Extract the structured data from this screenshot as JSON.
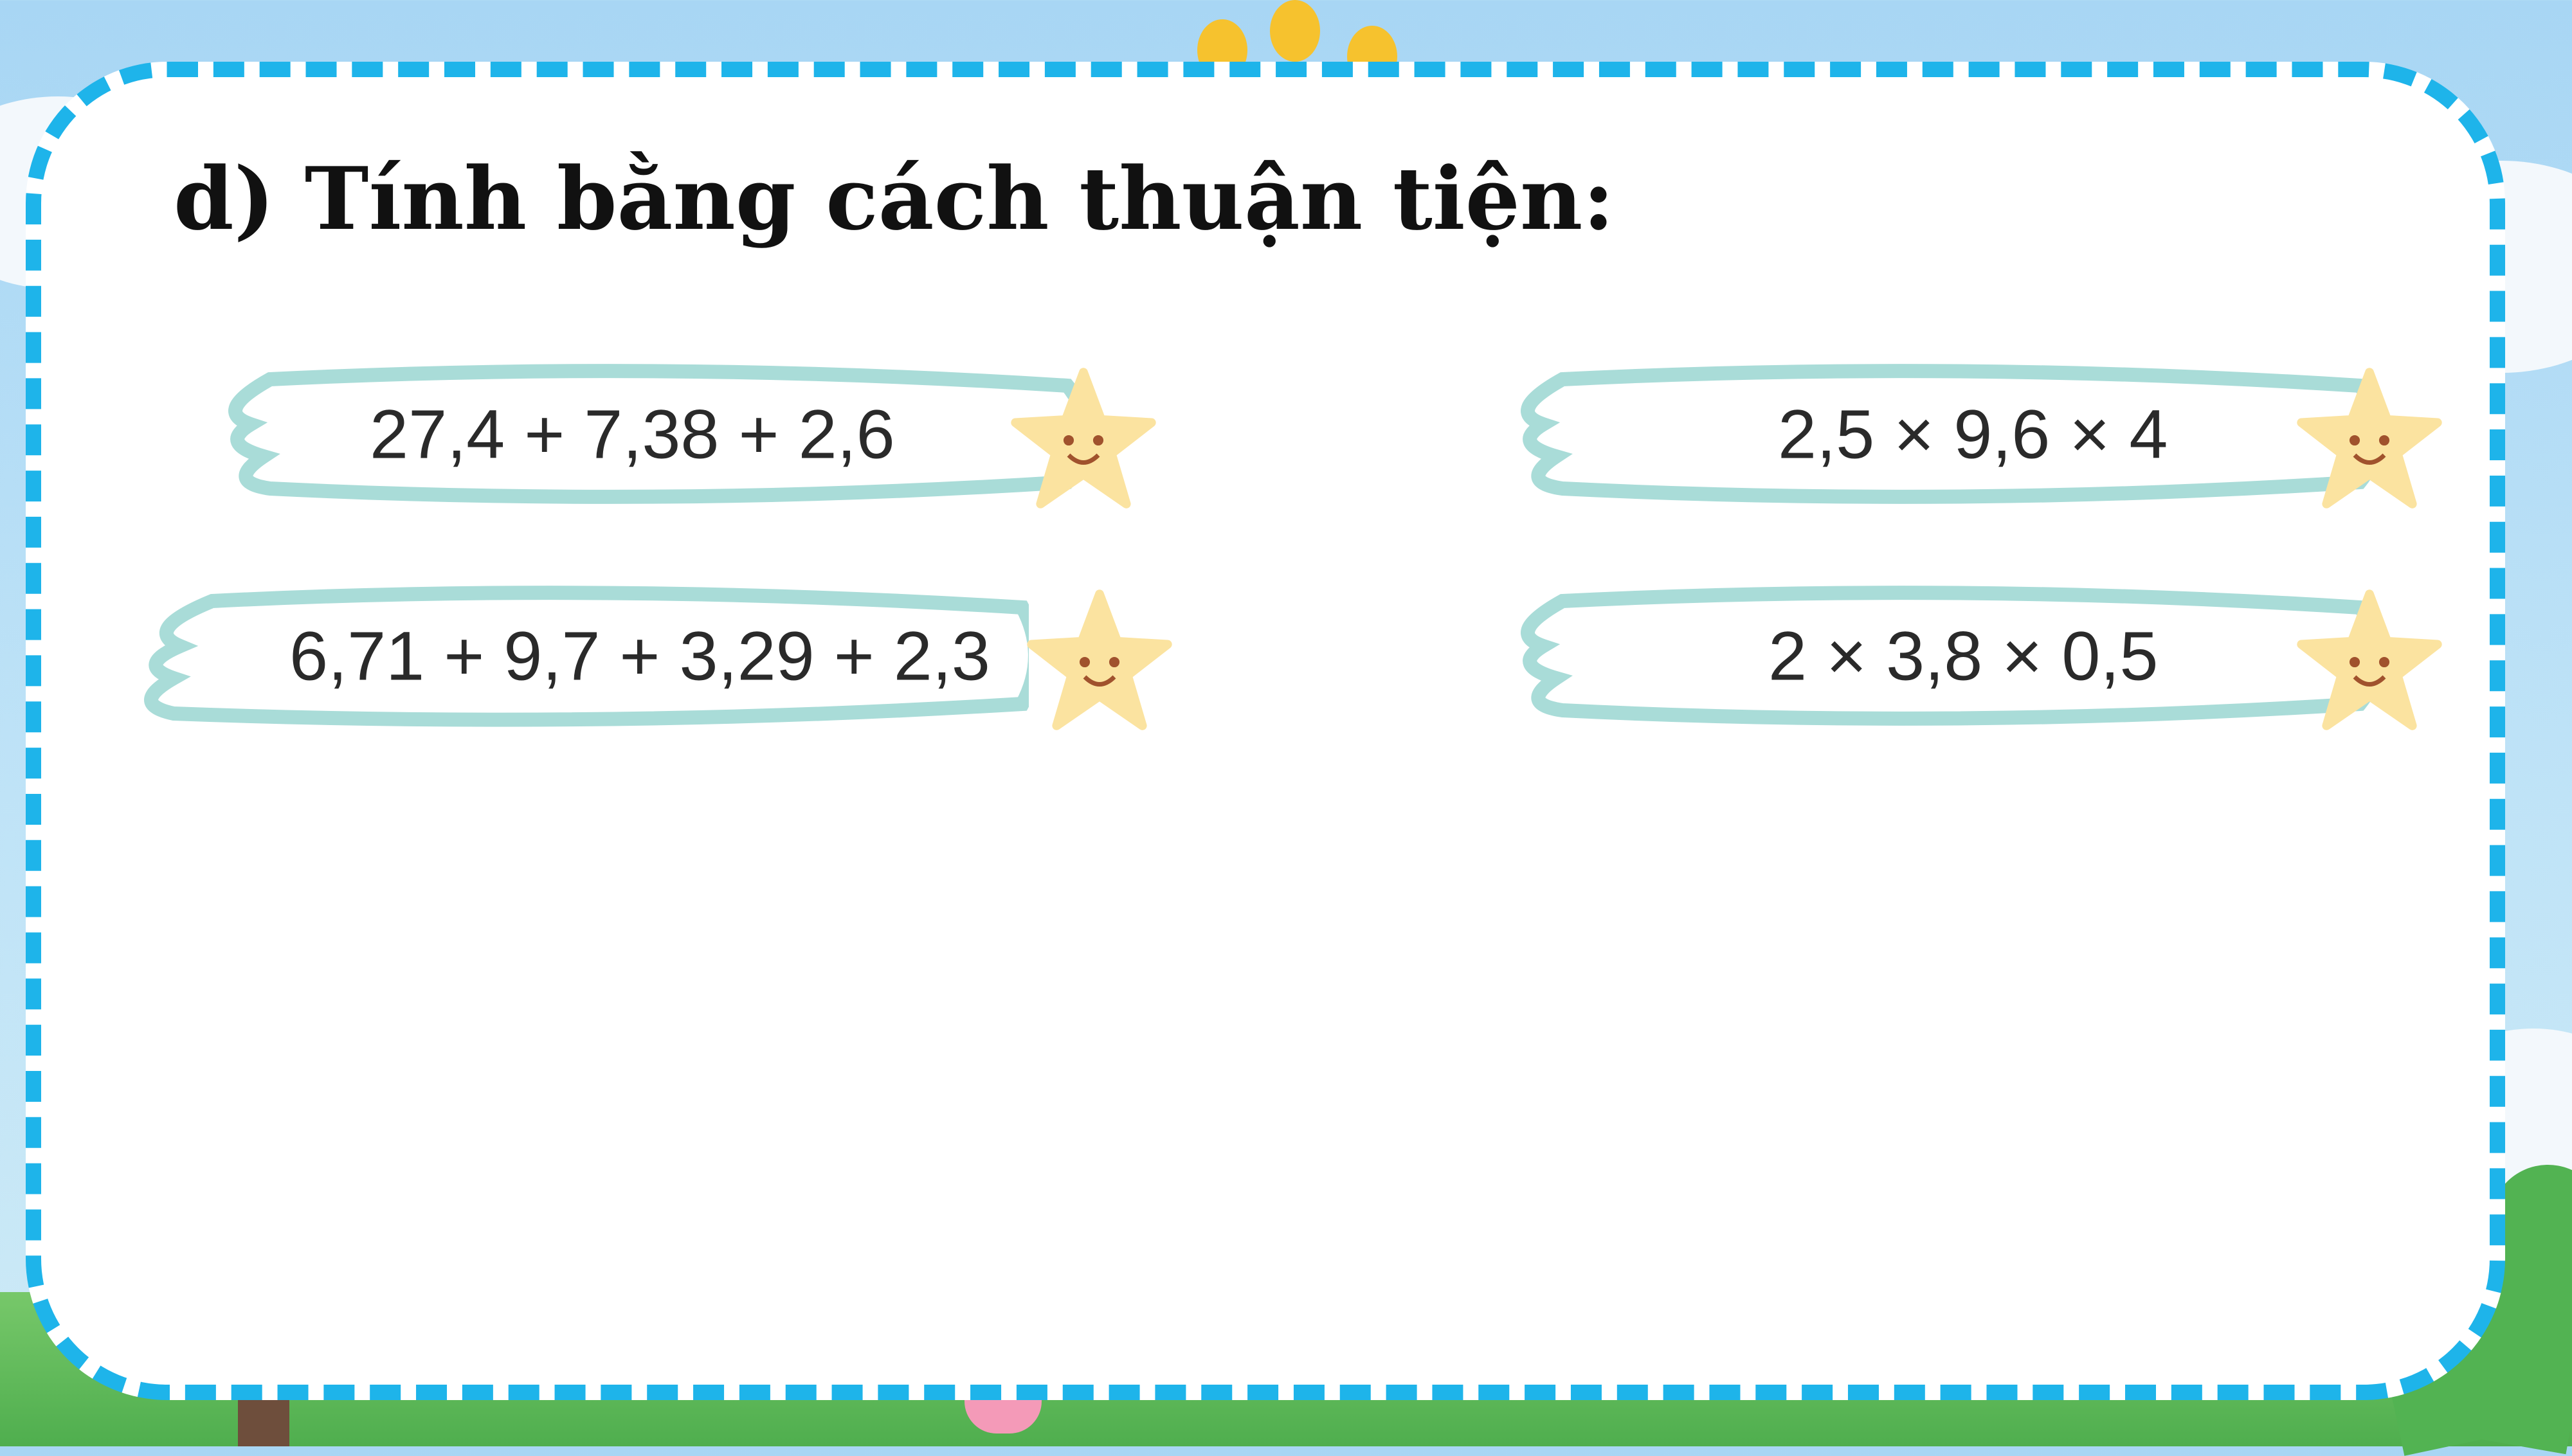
{
  "title": "d) Tính bằng cách thuận tiện:",
  "problems": [
    {
      "expr": "27,4 + 7,38 + 2,6"
    },
    {
      "expr": "6,71 + 9,7 + 3,29 + 2,3"
    },
    {
      "expr": "2,5 × 9,6 × 4"
    },
    {
      "expr": "2 × 3,8 × 0,5"
    }
  ],
  "colors": {
    "border_dash": "#1eb4ea",
    "pill_outline": "#a9dcd8",
    "star": "#fbe3a0",
    "sky": "#a8d6f4"
  },
  "icons": [
    "star-smiley-icon"
  ]
}
